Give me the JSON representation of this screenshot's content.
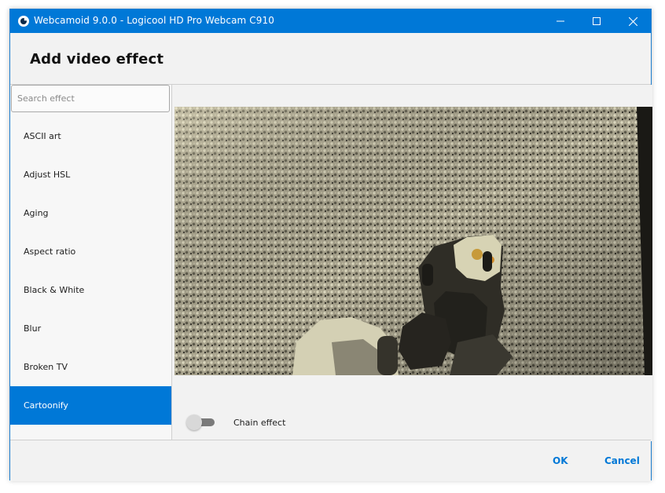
{
  "window": {
    "title": "Webcamoid 9.0.0 - Logicool HD Pro Webcam C910",
    "controls": [
      "minimize-icon",
      "maximize-icon",
      "close-icon"
    ]
  },
  "header": {
    "title": "Add video effect"
  },
  "search": {
    "placeholder": "Search effect",
    "value": ""
  },
  "effects": {
    "items": [
      {
        "label": "ASCII art"
      },
      {
        "label": "Adjust HSL"
      },
      {
        "label": "Aging"
      },
      {
        "label": "Aspect ratio"
      },
      {
        "label": "Black & White"
      },
      {
        "label": "Blur"
      },
      {
        "label": "Broken TV"
      },
      {
        "label": "Cartoonify"
      }
    ],
    "selected": "Cartoonify"
  },
  "chain": {
    "label": "Chain effect",
    "enabled": false
  },
  "footer": {
    "ok_label": "OK",
    "cancel_label": "Cancel"
  },
  "colors": {
    "accent": "#0078d7",
    "titlebar": "#0078d7",
    "background": "#f2f2f2"
  }
}
